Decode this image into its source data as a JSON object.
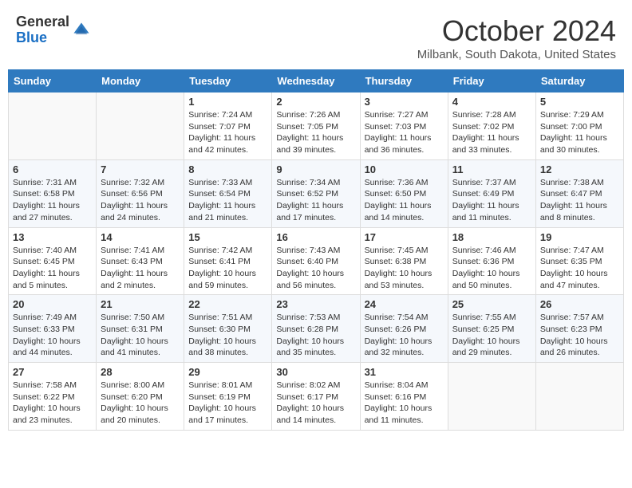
{
  "header": {
    "logo_general": "General",
    "logo_blue": "Blue",
    "month_title": "October 2024",
    "location": "Milbank, South Dakota, United States"
  },
  "days_of_week": [
    "Sunday",
    "Monday",
    "Tuesday",
    "Wednesday",
    "Thursday",
    "Friday",
    "Saturday"
  ],
  "weeks": [
    [
      {
        "day": "",
        "sunrise": "",
        "sunset": "",
        "daylight": ""
      },
      {
        "day": "",
        "sunrise": "",
        "sunset": "",
        "daylight": ""
      },
      {
        "day": "1",
        "sunrise": "Sunrise: 7:24 AM",
        "sunset": "Sunset: 7:07 PM",
        "daylight": "Daylight: 11 hours and 42 minutes."
      },
      {
        "day": "2",
        "sunrise": "Sunrise: 7:26 AM",
        "sunset": "Sunset: 7:05 PM",
        "daylight": "Daylight: 11 hours and 39 minutes."
      },
      {
        "day": "3",
        "sunrise": "Sunrise: 7:27 AM",
        "sunset": "Sunset: 7:03 PM",
        "daylight": "Daylight: 11 hours and 36 minutes."
      },
      {
        "day": "4",
        "sunrise": "Sunrise: 7:28 AM",
        "sunset": "Sunset: 7:02 PM",
        "daylight": "Daylight: 11 hours and 33 minutes."
      },
      {
        "day": "5",
        "sunrise": "Sunrise: 7:29 AM",
        "sunset": "Sunset: 7:00 PM",
        "daylight": "Daylight: 11 hours and 30 minutes."
      }
    ],
    [
      {
        "day": "6",
        "sunrise": "Sunrise: 7:31 AM",
        "sunset": "Sunset: 6:58 PM",
        "daylight": "Daylight: 11 hours and 27 minutes."
      },
      {
        "day": "7",
        "sunrise": "Sunrise: 7:32 AM",
        "sunset": "Sunset: 6:56 PM",
        "daylight": "Daylight: 11 hours and 24 minutes."
      },
      {
        "day": "8",
        "sunrise": "Sunrise: 7:33 AM",
        "sunset": "Sunset: 6:54 PM",
        "daylight": "Daylight: 11 hours and 21 minutes."
      },
      {
        "day": "9",
        "sunrise": "Sunrise: 7:34 AM",
        "sunset": "Sunset: 6:52 PM",
        "daylight": "Daylight: 11 hours and 17 minutes."
      },
      {
        "day": "10",
        "sunrise": "Sunrise: 7:36 AM",
        "sunset": "Sunset: 6:50 PM",
        "daylight": "Daylight: 11 hours and 14 minutes."
      },
      {
        "day": "11",
        "sunrise": "Sunrise: 7:37 AM",
        "sunset": "Sunset: 6:49 PM",
        "daylight": "Daylight: 11 hours and 11 minutes."
      },
      {
        "day": "12",
        "sunrise": "Sunrise: 7:38 AM",
        "sunset": "Sunset: 6:47 PM",
        "daylight": "Daylight: 11 hours and 8 minutes."
      }
    ],
    [
      {
        "day": "13",
        "sunrise": "Sunrise: 7:40 AM",
        "sunset": "Sunset: 6:45 PM",
        "daylight": "Daylight: 11 hours and 5 minutes."
      },
      {
        "day": "14",
        "sunrise": "Sunrise: 7:41 AM",
        "sunset": "Sunset: 6:43 PM",
        "daylight": "Daylight: 11 hours and 2 minutes."
      },
      {
        "day": "15",
        "sunrise": "Sunrise: 7:42 AM",
        "sunset": "Sunset: 6:41 PM",
        "daylight": "Daylight: 10 hours and 59 minutes."
      },
      {
        "day": "16",
        "sunrise": "Sunrise: 7:43 AM",
        "sunset": "Sunset: 6:40 PM",
        "daylight": "Daylight: 10 hours and 56 minutes."
      },
      {
        "day": "17",
        "sunrise": "Sunrise: 7:45 AM",
        "sunset": "Sunset: 6:38 PM",
        "daylight": "Daylight: 10 hours and 53 minutes."
      },
      {
        "day": "18",
        "sunrise": "Sunrise: 7:46 AM",
        "sunset": "Sunset: 6:36 PM",
        "daylight": "Daylight: 10 hours and 50 minutes."
      },
      {
        "day": "19",
        "sunrise": "Sunrise: 7:47 AM",
        "sunset": "Sunset: 6:35 PM",
        "daylight": "Daylight: 10 hours and 47 minutes."
      }
    ],
    [
      {
        "day": "20",
        "sunrise": "Sunrise: 7:49 AM",
        "sunset": "Sunset: 6:33 PM",
        "daylight": "Daylight: 10 hours and 44 minutes."
      },
      {
        "day": "21",
        "sunrise": "Sunrise: 7:50 AM",
        "sunset": "Sunset: 6:31 PM",
        "daylight": "Daylight: 10 hours and 41 minutes."
      },
      {
        "day": "22",
        "sunrise": "Sunrise: 7:51 AM",
        "sunset": "Sunset: 6:30 PM",
        "daylight": "Daylight: 10 hours and 38 minutes."
      },
      {
        "day": "23",
        "sunrise": "Sunrise: 7:53 AM",
        "sunset": "Sunset: 6:28 PM",
        "daylight": "Daylight: 10 hours and 35 minutes."
      },
      {
        "day": "24",
        "sunrise": "Sunrise: 7:54 AM",
        "sunset": "Sunset: 6:26 PM",
        "daylight": "Daylight: 10 hours and 32 minutes."
      },
      {
        "day": "25",
        "sunrise": "Sunrise: 7:55 AM",
        "sunset": "Sunset: 6:25 PM",
        "daylight": "Daylight: 10 hours and 29 minutes."
      },
      {
        "day": "26",
        "sunrise": "Sunrise: 7:57 AM",
        "sunset": "Sunset: 6:23 PM",
        "daylight": "Daylight: 10 hours and 26 minutes."
      }
    ],
    [
      {
        "day": "27",
        "sunrise": "Sunrise: 7:58 AM",
        "sunset": "Sunset: 6:22 PM",
        "daylight": "Daylight: 10 hours and 23 minutes."
      },
      {
        "day": "28",
        "sunrise": "Sunrise: 8:00 AM",
        "sunset": "Sunset: 6:20 PM",
        "daylight": "Daylight: 10 hours and 20 minutes."
      },
      {
        "day": "29",
        "sunrise": "Sunrise: 8:01 AM",
        "sunset": "Sunset: 6:19 PM",
        "daylight": "Daylight: 10 hours and 17 minutes."
      },
      {
        "day": "30",
        "sunrise": "Sunrise: 8:02 AM",
        "sunset": "Sunset: 6:17 PM",
        "daylight": "Daylight: 10 hours and 14 minutes."
      },
      {
        "day": "31",
        "sunrise": "Sunrise: 8:04 AM",
        "sunset": "Sunset: 6:16 PM",
        "daylight": "Daylight: 10 hours and 11 minutes."
      },
      {
        "day": "",
        "sunrise": "",
        "sunset": "",
        "daylight": ""
      },
      {
        "day": "",
        "sunrise": "",
        "sunset": "",
        "daylight": ""
      }
    ]
  ]
}
